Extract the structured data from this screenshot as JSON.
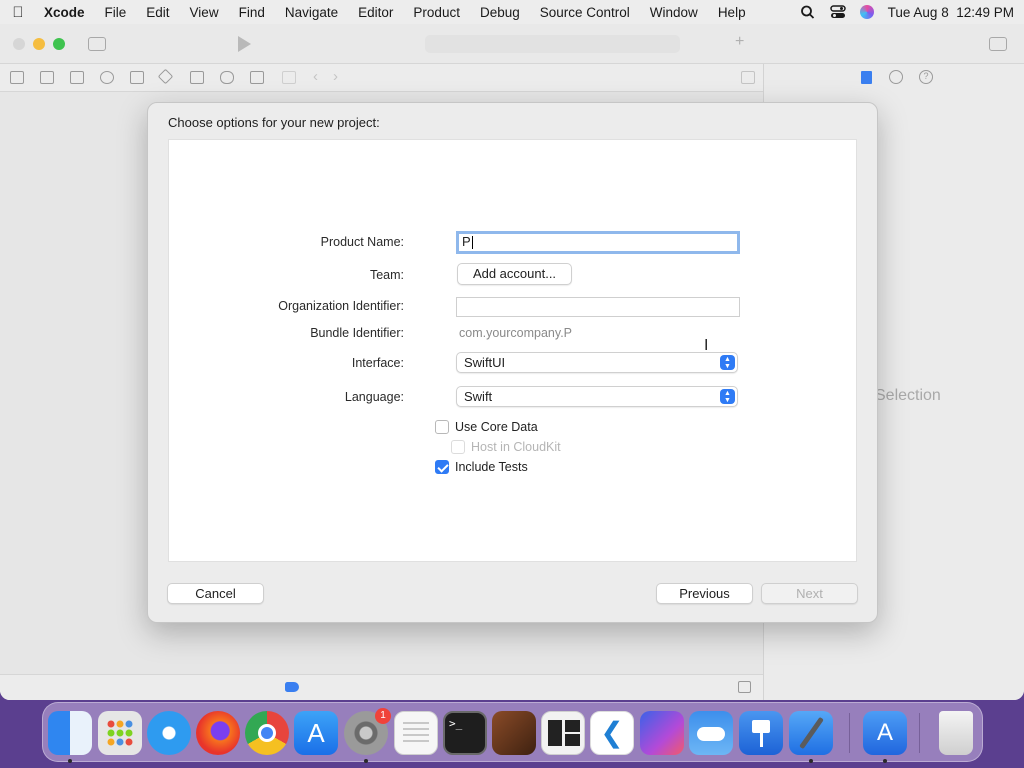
{
  "menubar": {
    "app_name": "Xcode",
    "items": [
      "File",
      "Edit",
      "View",
      "Find",
      "Navigate",
      "Editor",
      "Product",
      "Debug",
      "Source Control",
      "Window",
      "Help"
    ],
    "clock": "Tue Aug 8  12:49 PM"
  },
  "editor": {
    "no_selection": "Selection"
  },
  "dialog": {
    "title": "Choose options for your new project:",
    "product_name_label": "Product Name:",
    "product_name_value": "P",
    "team_label": "Team:",
    "add_account_button": "Add account...",
    "org_identifier_label": "Organization Identifier:",
    "org_identifier_value": "",
    "bundle_identifier_label": "Bundle Identifier:",
    "bundle_identifier_value": "com.yourcompany.P",
    "interface_label": "Interface:",
    "interface_value": "SwiftUI",
    "language_label": "Language:",
    "language_value": "Swift",
    "use_core_data_label": "Use Core Data",
    "use_core_data_checked": false,
    "host_in_cloudkit_label": "Host in CloudKit",
    "host_in_cloudkit_checked": false,
    "include_tests_label": "Include Tests",
    "include_tests_checked": true,
    "cancel_button": "Cancel",
    "previous_button": "Previous",
    "next_button": "Next"
  },
  "dock": {
    "apps": [
      {
        "name": "finder-icon",
        "color": "#3b8cf0"
      },
      {
        "name": "launchpad-icon",
        "color": "#e8e8e8"
      },
      {
        "name": "safari-icon",
        "color": "#2e9bf0"
      },
      {
        "name": "firefox-icon",
        "color": "#e8592b"
      },
      {
        "name": "chrome-icon",
        "color": "#f2f2f2"
      },
      {
        "name": "app-store-icon",
        "color": "#1f8df5"
      },
      {
        "name": "system-settings-icon",
        "color": "#8a8a8a",
        "badge": "1"
      },
      {
        "name": "textedit-icon",
        "color": "#f4f4f4"
      },
      {
        "name": "terminal-icon",
        "color": "#1e1e1e"
      },
      {
        "name": "instruments-icon",
        "color": "#6a3a20"
      },
      {
        "name": "window-manager-icon",
        "color": "#2a2a2a"
      },
      {
        "name": "vscode-icon",
        "color": "#ffffff"
      },
      {
        "name": "shortcuts-icon",
        "color": "#6b4be0"
      },
      {
        "name": "weather-icon",
        "color": "#3c86e6"
      },
      {
        "name": "keynote-icon",
        "color": "#2a7de4"
      },
      {
        "name": "xcode-icon",
        "color": "#3a8ef0"
      },
      {
        "name": "simulator-app-icon",
        "color": "#2d7fe8"
      },
      {
        "name": "trash-icon",
        "color": "#dcdcdc"
      }
    ]
  }
}
